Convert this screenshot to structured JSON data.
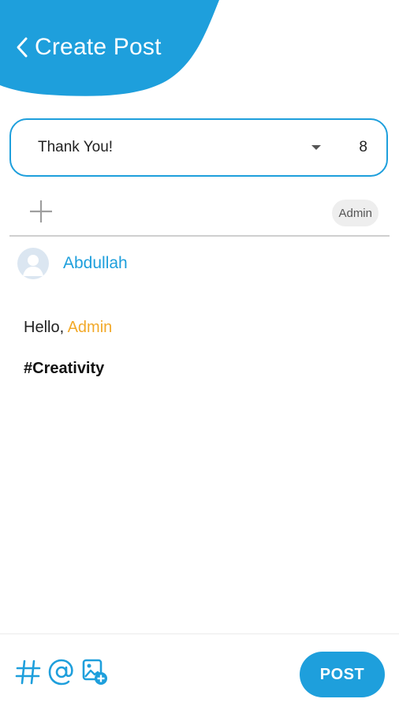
{
  "header": {
    "title": "Create Post"
  },
  "post_type": {
    "selected": "Thank You!",
    "count": "8"
  },
  "recipients": {
    "chips": [
      "Admin"
    ]
  },
  "author": {
    "name": "Abdullah"
  },
  "message": {
    "greeting": "Hello, ",
    "mention": "Admin",
    "hashtag": "#Creativity"
  },
  "toolbar": {
    "post_label": "POST"
  },
  "colors": {
    "accent": "#1e9fdc",
    "mention": "#f2a929"
  }
}
